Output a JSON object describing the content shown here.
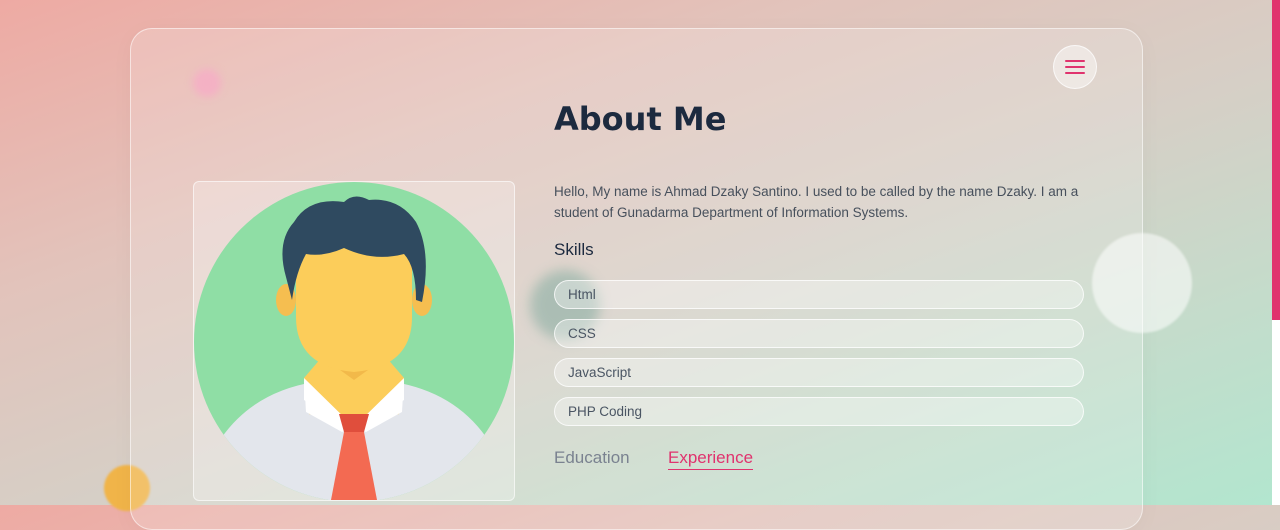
{
  "page": {
    "title": "About Me"
  },
  "about": {
    "bio": "Hello, My name is Ahmad Dzaky Santino. I used to be called by the name Dzaky. I am a student of Gunadarma Department of Information Systems."
  },
  "skills": {
    "heading": "Skills",
    "items": [
      "Html",
      "CSS",
      "JavaScript",
      "PHP Coding"
    ]
  },
  "tabs": {
    "education": "Education",
    "experience": "Experience",
    "active": "experience"
  },
  "menu": {
    "icon": "hamburger-menu-icon"
  },
  "colors": {
    "accent": "#e0336e",
    "heading": "#1c2a3f",
    "avatar_bg": "#8fdea5",
    "hair": "#2f4a60",
    "face": "#fccd5a",
    "tie": "#f36a52"
  }
}
